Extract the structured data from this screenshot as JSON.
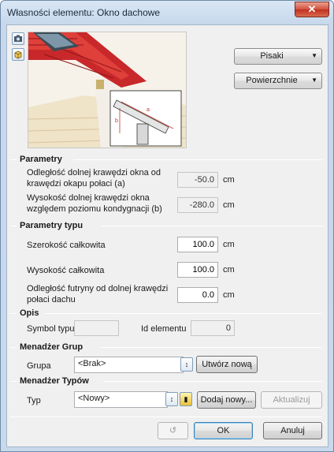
{
  "window": {
    "title": "Własności elementu: Okno dachowe",
    "close_glyph": "✕"
  },
  "toolbar": {
    "view_icon": "camera-icon",
    "view3d_icon": "cube-icon"
  },
  "buttons": {
    "pens": "Pisaki",
    "surfaces": "Powierzchnie"
  },
  "preview": {
    "label_a": "a",
    "label_b": "b"
  },
  "params": {
    "header": "Parametry",
    "rows": [
      {
        "label": "Odległość dolnej krawędzi okna od krawędzi okapu połaci (a)",
        "value": "-50.0",
        "unit": "cm"
      },
      {
        "label": "Wysokość dolnej krawędzi okna względem poziomu kondygnacji (b)",
        "value": "-280.0",
        "unit": "cm"
      }
    ]
  },
  "type_params": {
    "header": "Parametry typu",
    "rows": [
      {
        "label": "Szerokość całkowita",
        "value": "100.0",
        "unit": "cm"
      },
      {
        "label": "Wysokość całkowita",
        "value": "100.0",
        "unit": "cm"
      },
      {
        "label": "Odległość futryny od dolnej krawędzi połaci dachu",
        "value": "0.0",
        "unit": "cm"
      }
    ]
  },
  "description": {
    "header": "Opis",
    "symbol_label": "Symbol typu",
    "symbol_value": "",
    "id_label": "Id elementu",
    "id_value": "0"
  },
  "group_manager": {
    "header": "Menadżer Grup",
    "group_label": "Grupa",
    "group_value": "<Brak>",
    "create_button": "Utwórz nową"
  },
  "type_manager": {
    "header": "Menadżer Typów",
    "type_label": "Typ",
    "type_value": "<Nowy>",
    "add_button": "Dodaj nowy...",
    "update_button": "Aktualizuj"
  },
  "footer": {
    "undo_icon": "undo-icon",
    "ok": "OK",
    "cancel": "Anuluj"
  }
}
